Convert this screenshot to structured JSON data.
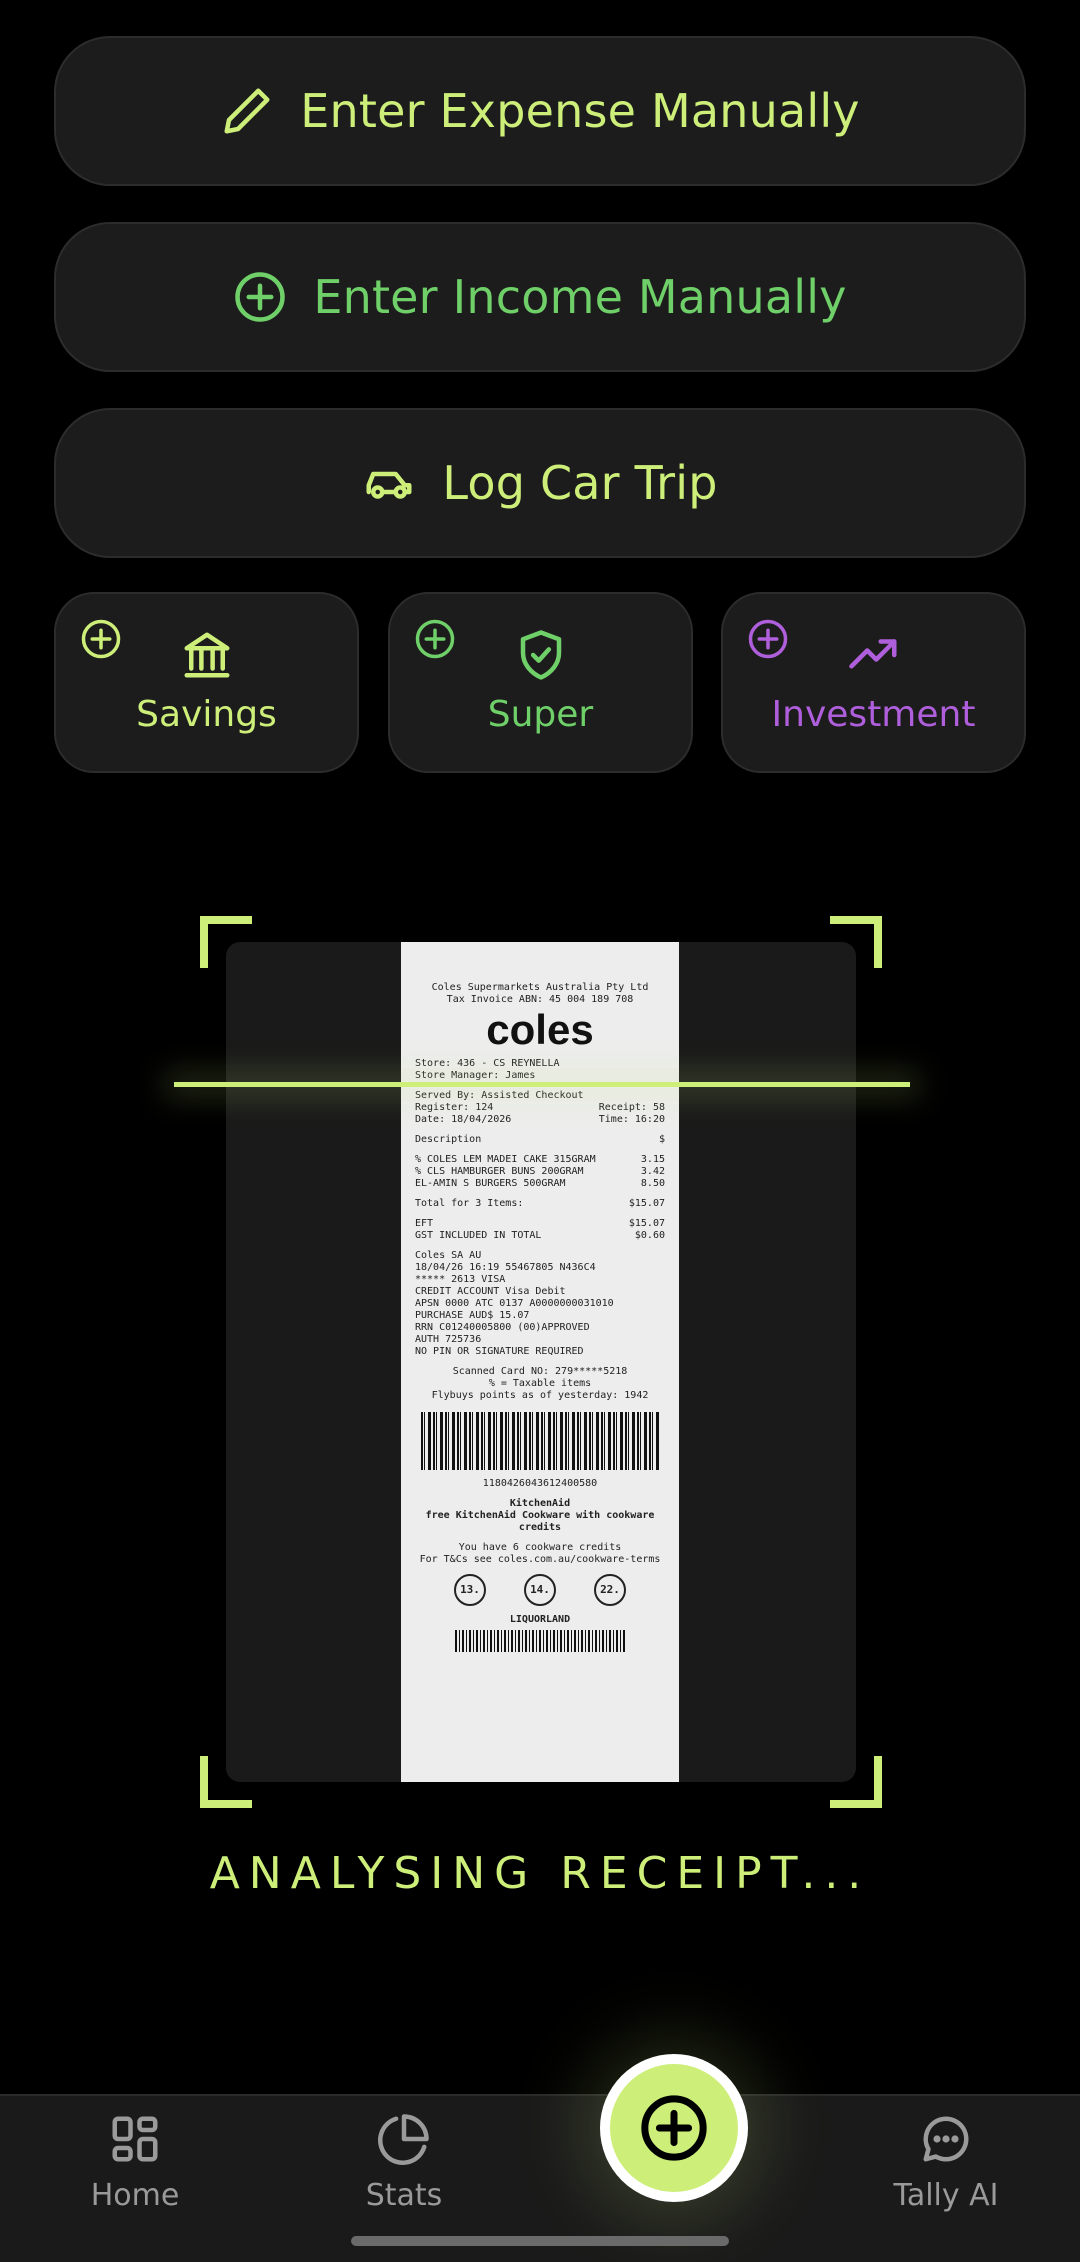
{
  "actions": {
    "expense_label": "Enter Expense Manually",
    "income_label": "Enter Income Manually",
    "car_label": "Log Car Trip"
  },
  "tiles": [
    {
      "label": "Savings",
      "icon": "bank-icon",
      "color": "#cdef7a"
    },
    {
      "label": "Super",
      "icon": "shield-check-icon",
      "color": "#6fcf68"
    },
    {
      "label": "Investment",
      "icon": "trending-up-icon",
      "color": "#b05fdc"
    }
  ],
  "receipt": {
    "company": "Coles Supermarkets Australia Pty Ltd",
    "tax_invoice": "Tax Invoice ABN: 45 004 189 708",
    "logo": "coles",
    "store": "Store: 436 - CS REYNELLA",
    "manager": "Store Manager: James",
    "served_by": "Served By: Assisted Checkout",
    "register": "Register: 124",
    "receipt_no": "Receipt: 58",
    "date": "Date: 18/04/2026",
    "time": "Time: 16:20",
    "desc_header": "Description",
    "currency": "$",
    "items": [
      {
        "name": "% COLES LEM MADEI CAKE 315GRAM",
        "price": "3.15"
      },
      {
        "name": "% CLS HAMBURGER BUNS 200GRAM",
        "price": "3.42"
      },
      {
        "name": "EL-AMIN S BURGERS 500GRAM",
        "price": "8.50"
      }
    ],
    "total_label": "Total for 3 Items:",
    "total": "$15.07",
    "eft_label": "EFT",
    "eft": "$15.07",
    "gst_label": "GST INCLUDED IN TOTAL",
    "gst": "$0.60",
    "bank_lines": [
      "Coles SA AU",
      "18/04/26 16:19 55467805 N436C4",
      "***** 2613 VISA",
      "CREDIT ACCOUNT Visa Debit",
      "APSN 0000 ATC 0137 A0000000031010",
      "PURCHASE AUD$ 15.07",
      "RRN C01240005800 (00)APPROVED",
      "AUTH 725736",
      "NO PIN OR SIGNATURE REQUIRED"
    ],
    "card_line": "Scanned Card NO: 279*****5218",
    "taxable_line": "% = Taxable items",
    "flybuys_line": "Flybuys points as of yesterday: 1942",
    "barcode_number": "1180426043612400580",
    "promo_title": "KitchenAid",
    "promo_line": "free KitchenAid Cookware with cookware credits",
    "credits_line": "You have 6 cookware credits",
    "terms_line": "For T&Cs see coles.com.au/cookware-terms",
    "circle_prices": [
      "13.",
      "14.",
      "22."
    ],
    "liquor": "LIQUORLAND"
  },
  "status_text": "ANALYSING RECEIPT...",
  "nav": {
    "home": "Home",
    "stats": "Stats",
    "tally": "Tally AI"
  },
  "colors": {
    "accent": "#cdef7a",
    "green": "#6fcf68",
    "purple": "#b05fdc"
  }
}
